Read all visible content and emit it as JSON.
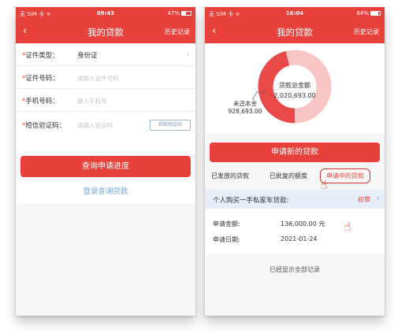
{
  "left": {
    "status": {
      "carrier": "无 SIM 卡 ᯤ",
      "time": "09:43",
      "battery": "47%",
      "battery_level": 0.47
    },
    "nav": {
      "back": "‹",
      "title": "我的贷款",
      "history": "历史记录"
    },
    "form": {
      "id_type": {
        "label": "证件类型：",
        "value": "身份证"
      },
      "id_number": {
        "label": "证件号码：",
        "placeholder": "请输入证件号码"
      },
      "phone": {
        "label": "手机号码：",
        "placeholder": "输入手机号"
      },
      "sms": {
        "label": "短信验证码：",
        "placeholder": "请输入验证码",
        "button": "获取验证码"
      }
    },
    "query_button": "查询申请进度",
    "login_button": "登录查询贷款"
  },
  "right": {
    "status": {
      "carrier": "无 SIM 卡 ᯤ",
      "time": "16:04",
      "battery": "84%",
      "battery_level": 0.84
    },
    "nav": {
      "back": "‹",
      "title": "我的贷款",
      "history": "历史记录"
    },
    "chart_data": {
      "type": "pie",
      "center_label": "贷款总金额",
      "center_value": "2,020,693.00",
      "slices": [
        {
          "label": "未还本金",
          "value": 928693.0,
          "display": "928,693.00",
          "color": "#e94a48"
        },
        {
          "label": "",
          "value": 1092000.0,
          "color": "#f7c6c4"
        }
      ]
    },
    "apply_new_button": "申请新的贷款",
    "tabs": {
      "issued": "已发放的贷款",
      "approved": "已批复的额度",
      "applying": "申请中的贷款"
    },
    "loan": {
      "name": "个人购买一手私家车贷款:",
      "status": "初审",
      "amount_label": "申请金额:",
      "amount_value": "136,000.00 元",
      "date_label": "申请日期:",
      "date_value": "2021-01-24"
    },
    "footer": "已经显示全部记录"
  }
}
